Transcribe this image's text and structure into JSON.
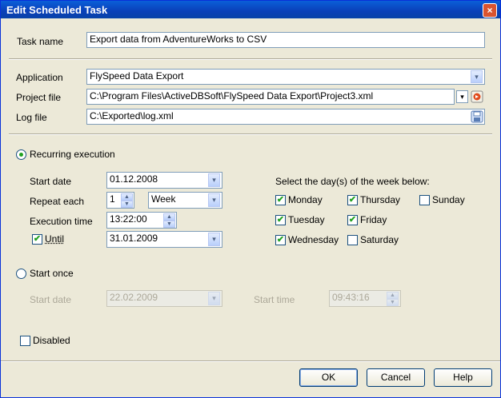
{
  "window": {
    "title": "Edit Scheduled Task",
    "close": "×"
  },
  "task": {
    "label": "Task name",
    "value": "Export data from AdventureWorks to CSV"
  },
  "application": {
    "label": "Application",
    "value": "FlySpeed Data Export"
  },
  "project_file": {
    "label": "Project file",
    "value": "C:\\Program Files\\ActiveDBSoft\\FlySpeed Data Export\\Project3.xml"
  },
  "log_file": {
    "label": "Log file",
    "value": "C:\\Exported\\log.xml"
  },
  "recurring": {
    "label": "Recurring execution",
    "selected": true,
    "start_date_label": "Start date",
    "start_date": "01.12.2008",
    "repeat_label": "Repeat each",
    "repeat_value": "1",
    "repeat_unit": "Week",
    "exec_time_label": "Execution time",
    "exec_time": "13:22:00",
    "until_label": "Until",
    "until_checked": true,
    "until_date": "31.01.2009",
    "days_prompt": "Select the day(s) of the week below:",
    "days": [
      {
        "label": "Monday",
        "checked": true
      },
      {
        "label": "Thursday",
        "checked": true
      },
      {
        "label": "Sunday",
        "checked": false
      },
      {
        "label": "Tuesday",
        "checked": true
      },
      {
        "label": "Friday",
        "checked": true
      },
      {
        "label": "Wednesday",
        "checked": true
      },
      {
        "label": "Saturday",
        "checked": false
      }
    ]
  },
  "start_once": {
    "label": "Start once",
    "selected": false,
    "start_date_label": "Start date",
    "start_date": "22.02.2009",
    "start_time_label": "Start time",
    "start_time": "09:43:16"
  },
  "disabled": {
    "label": "Disabled",
    "checked": false
  },
  "buttons": {
    "ok": "OK",
    "cancel": "Cancel",
    "help": "Help"
  },
  "colors": {
    "titlebar": "#0a4fc8",
    "check": "#21a121",
    "dialog_bg": "#ece9d8"
  },
  "icons": {
    "dropdown": "▾",
    "spin_up": "▲",
    "spin_down": "▼"
  }
}
